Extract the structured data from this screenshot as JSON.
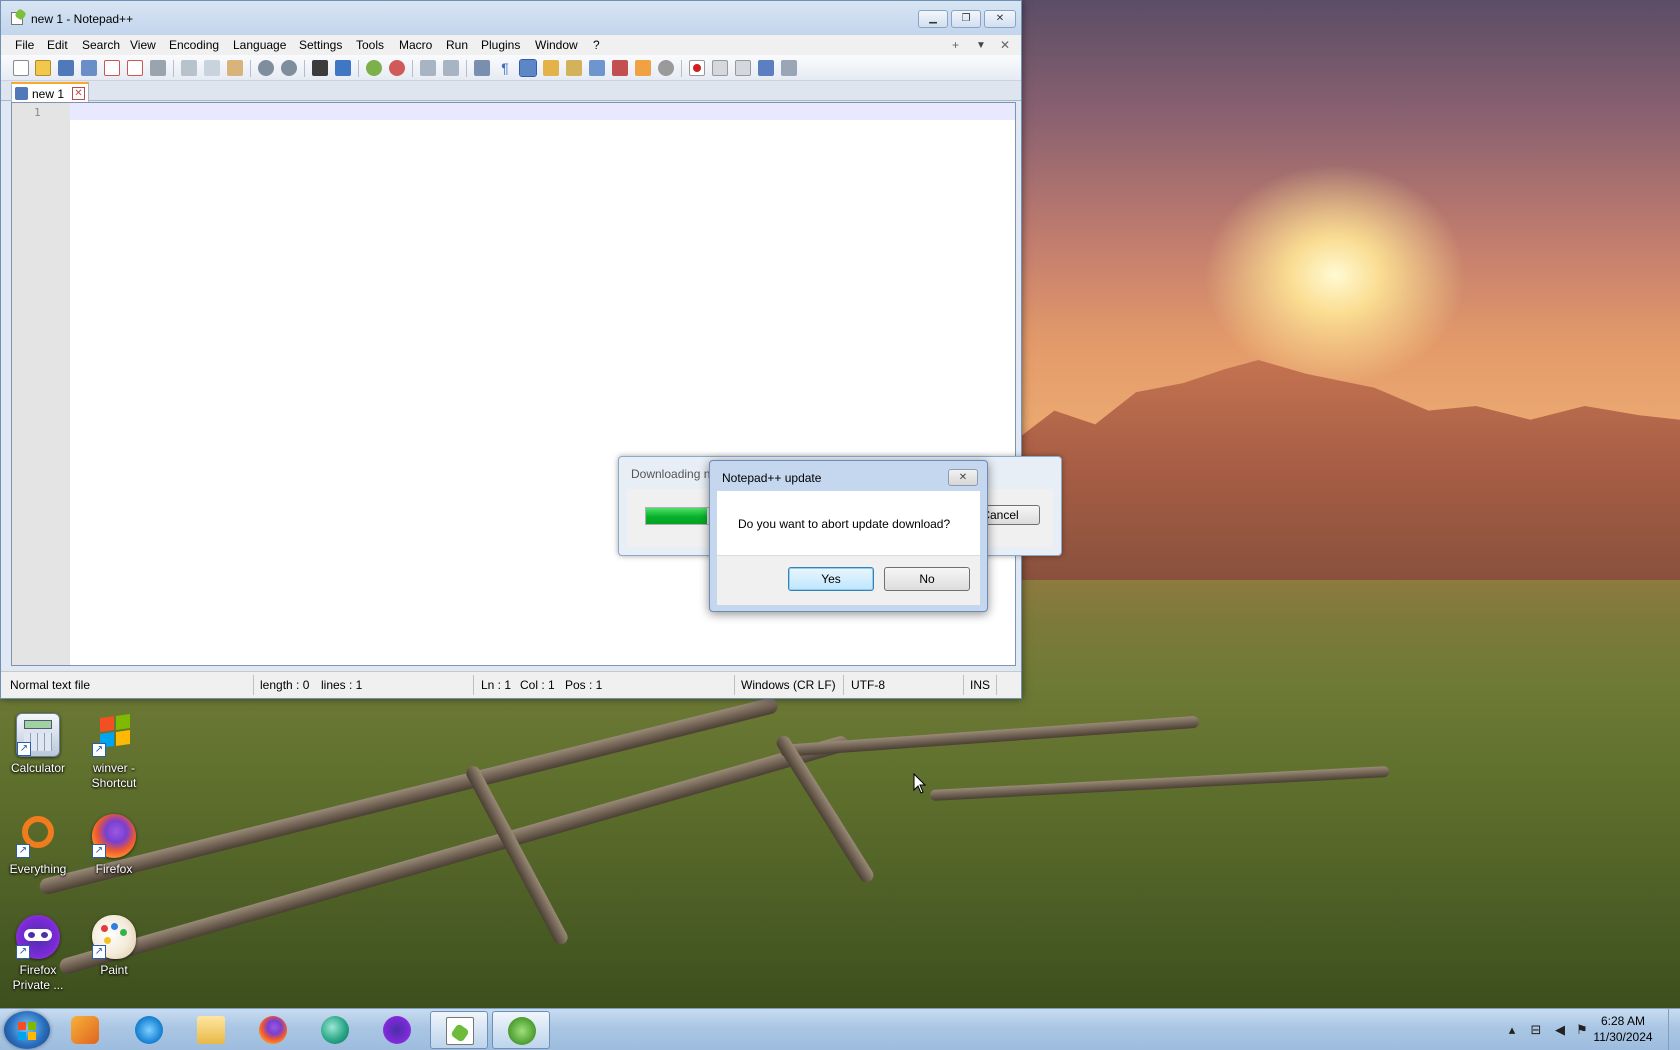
{
  "desktop": {
    "icons": [
      {
        "label": "Calculator",
        "icon": "calculator-icon"
      },
      {
        "label": "winver -\nShortcut",
        "icon": "windows-logo-icon"
      },
      {
        "label": "Everything",
        "icon": "everything-search-icon"
      },
      {
        "label": "Firefox",
        "icon": "firefox-icon"
      },
      {
        "label": "Firefox\nPrivate ...",
        "icon": "firefox-private-icon"
      },
      {
        "label": "Paint",
        "icon": "paint-icon"
      }
    ]
  },
  "notepad": {
    "title": "new 1 - Notepad++",
    "menu": [
      "File",
      "Edit",
      "Search",
      "View",
      "Encoding",
      "Language",
      "Settings",
      "Tools",
      "Macro",
      "Run",
      "Plugins",
      "Window",
      "?"
    ],
    "menu_right": [
      "+",
      "▼",
      "✕"
    ],
    "tab_label": "new 1",
    "line_number": "1",
    "status": {
      "file_type": "Normal text file",
      "length": "length : 0",
      "lines": "lines : 1",
      "ln": "Ln : 1",
      "col": "Col : 1",
      "pos": "Pos : 1",
      "eol": "Windows (CR LF)",
      "encoding": "UTF-8",
      "mode": "INS"
    }
  },
  "download_dialog": {
    "title": "Downloading n",
    "progress_percent": 22,
    "cancel_label": "Cancel"
  },
  "confirm_dialog": {
    "title": "Notepad++ update",
    "message": "Do you want to abort update download?",
    "yes_label": "Yes",
    "no_label": "No"
  },
  "taskbar": {
    "apps": [
      "media-player-icon",
      "internet-explorer-icon",
      "file-explorer-icon",
      "firefox-icon",
      "circle-app-icon",
      "firefox-private-icon",
      "notepadpp-icon",
      "updater-icon"
    ],
    "clock_time": "6:28 AM",
    "clock_date": "11/30/2024"
  },
  "colors": {
    "progress_green": "#07b12b",
    "title_blue": "#c2d5ec",
    "tab_accent": "#f6a82f"
  }
}
